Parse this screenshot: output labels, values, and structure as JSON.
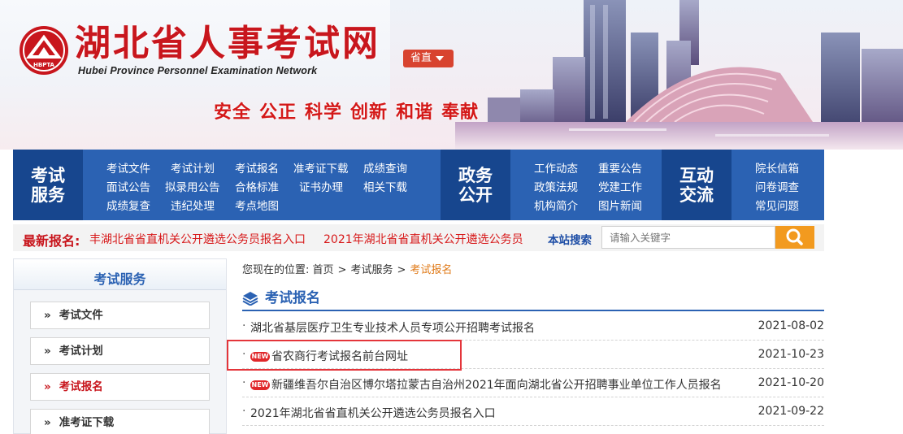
{
  "header": {
    "title": "湖北省人事考试网",
    "subtitle": "Hubei Province Personnel Examination Network",
    "logo_text": "HBPTA",
    "dept_button": "省直",
    "slogan": [
      "安全",
      "公正",
      "科学",
      "创新",
      "和谐",
      "奉献"
    ]
  },
  "nav": {
    "exam_service": {
      "heading": [
        "考试",
        "服务"
      ],
      "links": [
        "考试文件",
        "考试计划",
        "考试报名",
        "准考证下载",
        "成绩查询",
        "面试公告",
        "拟录用公告",
        "合格标准",
        "证书办理",
        "相关下载",
        "成绩复查",
        "违纪处理",
        "考点地图"
      ]
    },
    "government": {
      "heading": [
        "政务",
        "公开"
      ],
      "links": [
        "工作动态",
        "重要公告",
        "政策法规",
        "党建工作",
        "机构简介",
        "图片新闻"
      ]
    },
    "interaction": {
      "heading": [
        "互动",
        "交流"
      ],
      "links": [
        "院长信箱",
        "问卷调查",
        "常见问题"
      ]
    }
  },
  "latest": {
    "label": "最新报名:",
    "items": [
      "丰湖北省省直机关公开遴选公务员报名入口",
      "2021年湖北省省直机关公开遴选公务员"
    ]
  },
  "search": {
    "label": "本站搜索",
    "placeholder": "请输入关键字",
    "button_icon": "search-icon"
  },
  "sidebar": {
    "title": "考试服务",
    "items": [
      {
        "label": "考试文件",
        "active": false
      },
      {
        "label": "考试计划",
        "active": false
      },
      {
        "label": "考试报名",
        "active": true
      },
      {
        "label": "准考证下载",
        "active": false
      }
    ]
  },
  "breadcrumb": {
    "prefix": "您现在的位置:",
    "items": [
      "首页",
      "考试服务",
      "考试报名"
    ]
  },
  "section": {
    "title": "考试报名"
  },
  "list": [
    {
      "title": "湖北省基层医疗卫生专业技术人员专项公开招聘考试报名",
      "date": "2021-08-02",
      "new": false
    },
    {
      "title": "省农商行考试报名前台网址",
      "date": "2021-10-23",
      "new": true
    },
    {
      "title": "新疆维吾尔自治区博尔塔拉蒙古自治州2021年面向湖北省公开招聘事业单位工作人员报名",
      "date": "2021-10-20",
      "new": true
    },
    {
      "title": "2021年湖北省省直机关公开遴选公务员报名入口",
      "date": "2021-09-22",
      "new": false
    }
  ],
  "badge_text": "NEW",
  "colors": {
    "brand_red": "#c8161d",
    "nav_blue": "#2b62b3",
    "nav_dark_blue": "#17468e",
    "accent_orange": "#f29a1f",
    "highlight_red": "#e4353a"
  }
}
